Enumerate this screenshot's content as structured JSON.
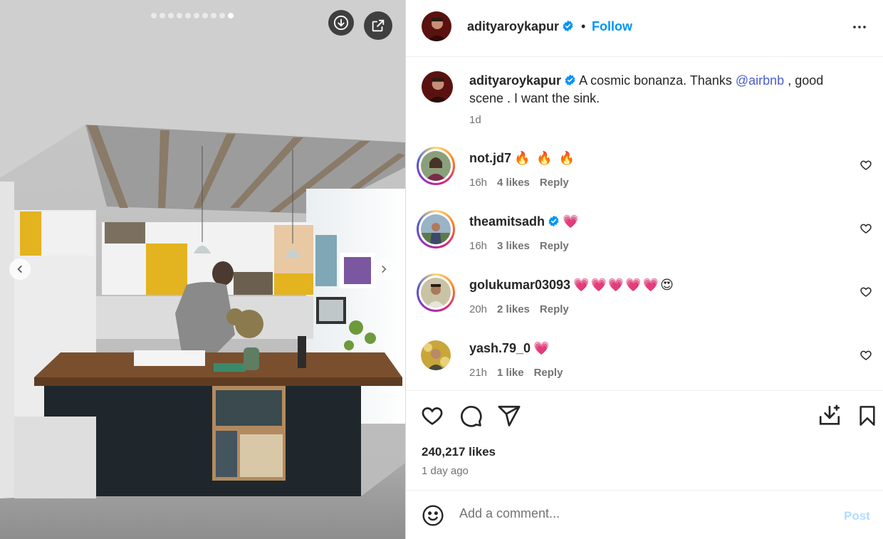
{
  "media": {
    "carousel_dots": 10,
    "active_dot": 9,
    "icons": {
      "download": "download-circle-icon",
      "external": "open-external-icon",
      "prev": "chevron-left-icon",
      "next": "chevron-right-icon"
    }
  },
  "header": {
    "username": "adityaroykapur",
    "separator": "•",
    "follow_label": "Follow",
    "more_icon": "more-horizontal-icon"
  },
  "caption": {
    "username": "adityaroykapur",
    "text_before": "A cosmic bonanza. Thanks ",
    "mention": "@airbnb",
    "text_after": " , good scene . I want the sink.",
    "time": "1d"
  },
  "comments": [
    {
      "username": "not.jd7",
      "emoji": "🔥 🔥 🔥",
      "time": "16h",
      "likes": "4 likes",
      "reply": "Reply",
      "verified": false
    },
    {
      "username": "theamitsadh",
      "emoji": "💗",
      "time": "16h",
      "likes": "3 likes",
      "reply": "Reply",
      "verified": true
    },
    {
      "username": "golukumar03093",
      "emoji": "💗💗💗💗💗😍",
      "time": "20h",
      "likes": "2 likes",
      "reply": "Reply",
      "verified": false
    },
    {
      "username": "yash.79_0",
      "emoji": "💗",
      "time": "21h",
      "likes": "1 like",
      "reply": "Reply",
      "verified": false
    }
  ],
  "actions": {
    "icons": [
      "heart-icon",
      "comment-icon",
      "share-icon",
      "save-download-icon",
      "bookmark-icon"
    ],
    "likes": "240,217 likes",
    "time": "1 day ago"
  },
  "composer": {
    "placeholder": "Add a comment...",
    "post_label": "Post"
  },
  "colors": {
    "accent": "#0095f6",
    "muted": "#737373",
    "mention": "#4a5dce",
    "verified": "#0095f6"
  }
}
